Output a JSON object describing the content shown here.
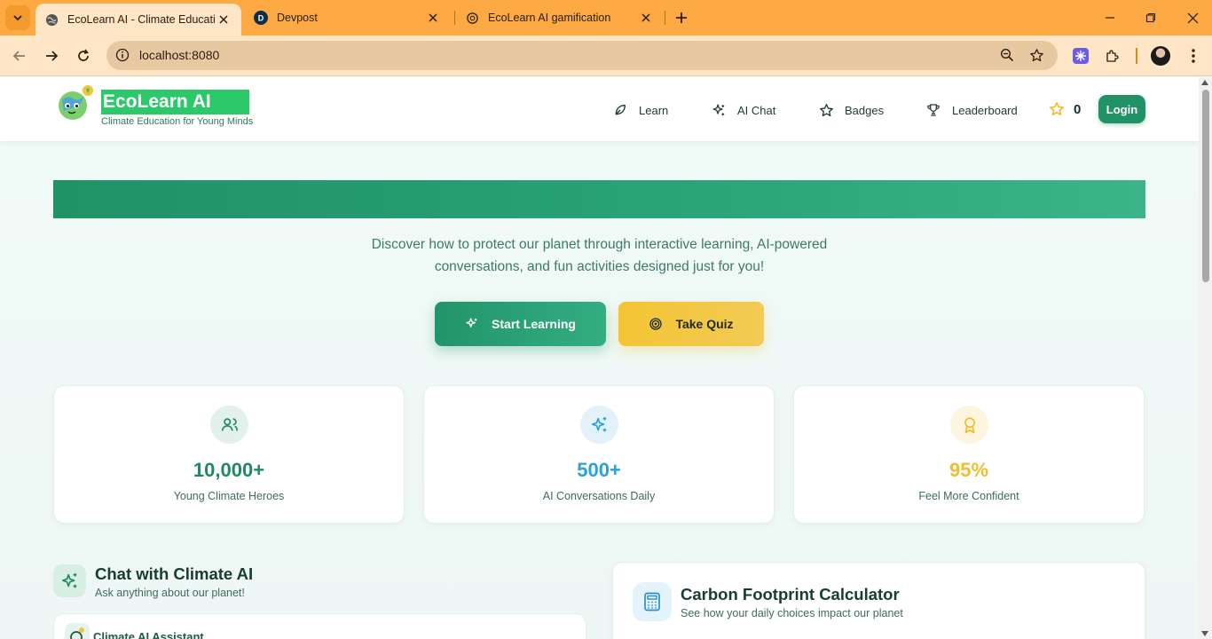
{
  "browser": {
    "tabs": [
      {
        "title": "EcoLearn AI - Climate Education",
        "favicon": "globe-icon",
        "active": true
      },
      {
        "title": "Devpost",
        "favicon": "devpost-icon",
        "active": false
      },
      {
        "title": "EcoLearn AI gamification",
        "favicon": "openai-icon",
        "active": false
      }
    ],
    "url": "localhost:8080"
  },
  "site": {
    "brand": "EcoLearn AI",
    "tagline": "Climate Education for Young Minds",
    "nav": [
      {
        "label": "Learn",
        "icon": "leaf-icon"
      },
      {
        "label": "AI Chat",
        "icon": "sparkles-icon"
      },
      {
        "label": "Badges",
        "icon": "star-icon"
      },
      {
        "label": "Leaderboard",
        "icon": "trophy-icon"
      }
    ],
    "points": "0",
    "login": "Login"
  },
  "hero": {
    "line1": "Discover how to protect our planet through interactive learning, AI-powered",
    "line2": "conversations, and fun activities designed just for you!",
    "start_button": "Start Learning",
    "quiz_button": "Take Quiz"
  },
  "stats": [
    {
      "value": "10,000+",
      "label": "Young Climate Heroes",
      "color": "#1f8a5f",
      "icon": "users-icon"
    },
    {
      "value": "500+",
      "label": "AI Conversations Daily",
      "color": "#2aa2d6",
      "icon": "sparkles-icon"
    },
    {
      "value": "95%",
      "label": "Feel More Confident",
      "color": "#f2bd2c",
      "icon": "award-icon"
    }
  ],
  "chat": {
    "title": "Chat with Climate AI",
    "subtitle": "Ask anything about our planet!",
    "assistant_name": "Climate AI Assistant"
  },
  "carbon": {
    "title": "Carbon Footprint Calculator",
    "subtitle": "See how your daily choices impact our planet"
  },
  "colors": {
    "primary": "#229266",
    "accent": "#f4c434",
    "chrome": "#fdaa44"
  }
}
